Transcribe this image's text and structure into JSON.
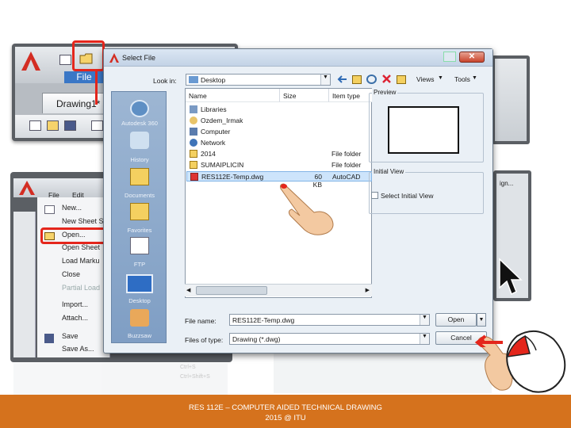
{
  "acad_top": {
    "tab_label": "Drawing1*",
    "file_label": "File"
  },
  "acad_menu": {
    "menu_bar": [
      "File",
      "Edit"
    ],
    "items": [
      "New...",
      "New Sheet S",
      "Open...",
      "Open Sheet",
      "Load Marku",
      "Close",
      "Partial Load",
      "Import...",
      "Attach...",
      "Save",
      "Save As..."
    ],
    "faded_shortcuts": [
      "Ctrl+S",
      "Ctrl+Shift+S"
    ]
  },
  "right_top_partial": "ign...",
  "dialog": {
    "title": "Select File",
    "look_in_label": "Look in:",
    "look_in_value": "Desktop",
    "toolbar_views": "Views",
    "toolbar_tools": "Tools",
    "columns": {
      "name": "Name",
      "size": "Size",
      "type": "Item type"
    },
    "rows": [
      {
        "name": "Libraries",
        "size": "",
        "type": ""
      },
      {
        "name": "Ozdem_Irmak",
        "size": "",
        "type": ""
      },
      {
        "name": "Computer",
        "size": "",
        "type": ""
      },
      {
        "name": "Network",
        "size": "",
        "type": ""
      },
      {
        "name": "2014",
        "size": "",
        "type": "File folder"
      },
      {
        "name": "SUMAIPLICIN",
        "size": "",
        "type": "File folder"
      },
      {
        "name": "RES112E-Temp.dwg",
        "size": "60 KB",
        "type": "AutoCAD"
      }
    ],
    "places": [
      "Autodesk 360",
      "History",
      "Documents",
      "Favorites",
      "FTP",
      "Desktop",
      "Buzzsaw"
    ],
    "preview_label": "Preview",
    "initial_view_label": "Initial View",
    "select_initial_view": "Select Initial View",
    "file_name_label": "File name:",
    "file_name_value": "RES112E-Temp.dwg",
    "files_of_type_label": "Files of type:",
    "files_of_type_value": "Drawing (*.dwg)",
    "open_button": "Open",
    "cancel_button": "Cancel"
  },
  "footer": {
    "line1": "RES 112E – COMPUTER AIDED TECHNICAL DRAWING",
    "line2": "2015 @ ITU"
  },
  "colors": {
    "highlight_red": "#e4261c",
    "footer_orange": "#d5721d",
    "places_blue": "#8aa8cb"
  }
}
